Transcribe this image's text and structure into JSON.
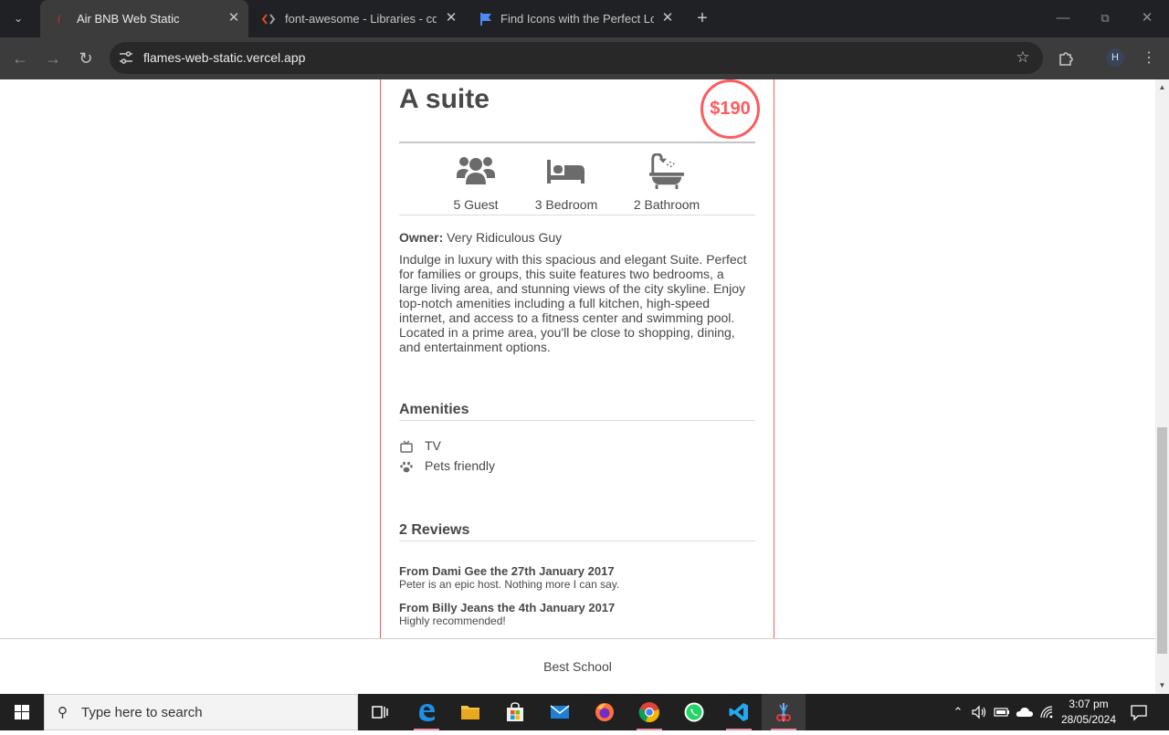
{
  "browser": {
    "tabs": [
      {
        "title": "Air BNB Web Static",
        "favicon": "airbnb-icon",
        "active": true
      },
      {
        "title": "font-awesome - Libraries - cdnjs",
        "favicon": "code-brackets-icon",
        "active": false
      },
      {
        "title": "Find Icons with the Perfect Look",
        "favicon": "flag-icon",
        "active": false
      }
    ],
    "url": "flames-web-static.vercel.app",
    "profile_initial": "H"
  },
  "place": {
    "name": "A suite",
    "price": "$190",
    "info": [
      {
        "icon": "users-icon",
        "label": "5 Guest"
      },
      {
        "icon": "bed-icon",
        "label": "3 Bedroom"
      },
      {
        "icon": "bath-icon",
        "label": "2 Bathroom"
      }
    ],
    "owner_label": "Owner:",
    "owner_name": "Very Ridiculous Guy",
    "description": "Indulge in luxury with this spacious and elegant Suite. Perfect for families or groups, this suite features two bedrooms, a large living area, and stunning views of the city skyline. Enjoy top-notch amenities including a full kitchen, high-speed internet, and access to a fitness center and swimming pool. Located in a prime area, you'll be close to shopping, dining, and entertainment options."
  },
  "amenities": {
    "heading": "Amenities",
    "items": [
      {
        "icon": "tv-icon",
        "label": "TV"
      },
      {
        "icon": "paw-icon",
        "label": "Pets friendly"
      }
    ]
  },
  "reviews": {
    "heading": "2 Reviews",
    "items": [
      {
        "header": "From Dami Gee the 27th January 2017",
        "text": "Peter is an epic host. Nothing more I can say."
      },
      {
        "header": "From Billy Jeans the 4th January 2017",
        "text": "Highly recommended!"
      }
    ]
  },
  "footer": {
    "text": "Best School"
  },
  "taskbar": {
    "search_placeholder": "Type here to search",
    "time": "3:07 pm",
    "date": "28/05/2024"
  },
  "colors": {
    "accent": "#ff5a5f",
    "text": "#484848",
    "icon_gray": "#6b6b6b"
  }
}
